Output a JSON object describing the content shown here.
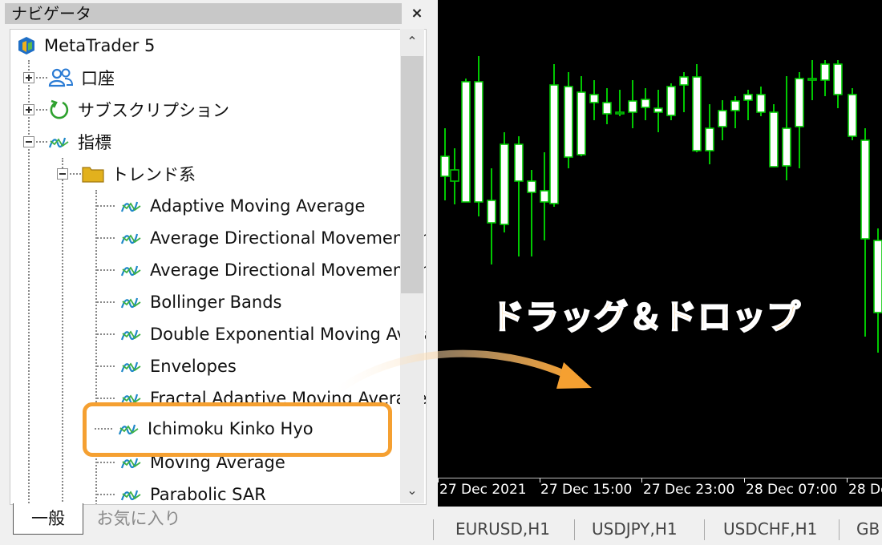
{
  "navigator": {
    "title": "ナビゲータ",
    "close": "×",
    "items": {
      "root": "MetaTrader 5",
      "accounts": "口座",
      "subscriptions": "サブスクリプション",
      "indicators": "指標",
      "trend_folder": "トレンド系"
    },
    "indicators": [
      "Adaptive Moving Average",
      "Average Directional Movement Index",
      "Average Directional Movement Index Wilder",
      "Bollinger Bands",
      "Double Exponential Moving Average",
      "Envelopes",
      "Fractal Adaptive Moving Average",
      "Ichimoku Kinko Hyo",
      "Moving Average",
      "Parabolic SAR"
    ],
    "highlighted": "Ichimoku Kinko Hyo",
    "tabs": {
      "general": "一般",
      "favorites": "お気に入り"
    }
  },
  "annotation": "ドラッグ＆ドロップ",
  "chart": {
    "time_labels": [
      "27 Dec 2021",
      "27 Dec 15:00",
      "27 Dec 23:00",
      "28 Dec 07:00",
      "28 Dec"
    ],
    "symbol_tabs": [
      "EURUSD,H1",
      "USDJPY,H1",
      "USDCHF,H1",
      "GB"
    ],
    "colors": {
      "background": "#000000",
      "candle": "#00c800",
      "bull_body": "#ffffff"
    }
  }
}
